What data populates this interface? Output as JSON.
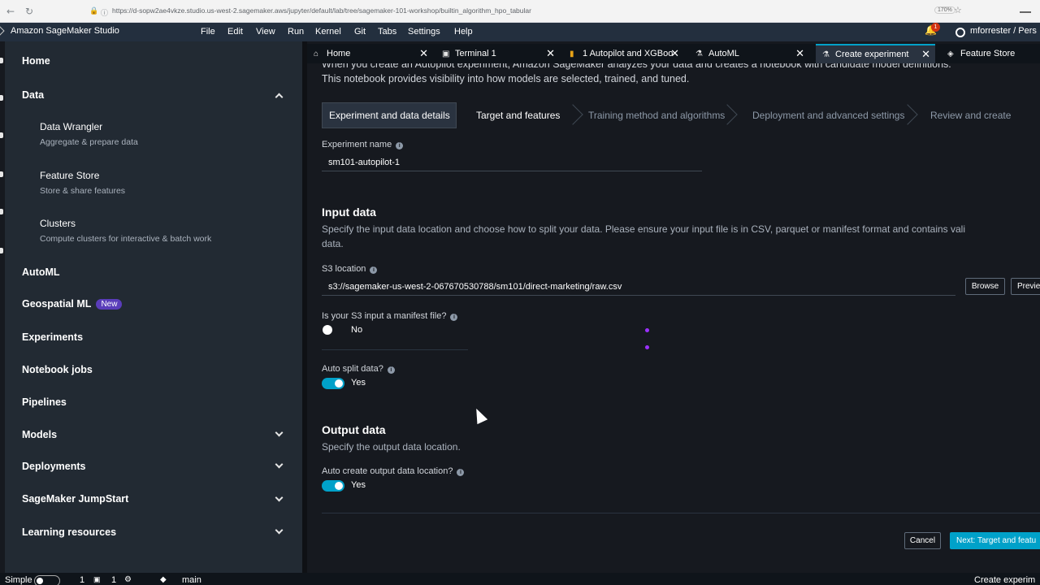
{
  "browser": {
    "url": "https://d-sopw2ae4vkze.studio.us-west-2.sagemaker.aws/jupyter/default/lab/tree/sagemaker-101-workshop/builtin_algorithm_hpo_tabular",
    "zoom": "170%"
  },
  "app": {
    "title": "Amazon SageMaker Studio",
    "menu": [
      "File",
      "Edit",
      "View",
      "Run",
      "Kernel",
      "Git",
      "Tabs",
      "Settings",
      "Help"
    ],
    "notification_count": "1",
    "user": "mforrester / Pers"
  },
  "sidebar": {
    "home": "Home",
    "data": {
      "label": "Data",
      "items": [
        {
          "title": "Data Wrangler",
          "desc": "Aggregate & prepare data"
        },
        {
          "title": "Feature Store",
          "desc": "Store & share features"
        },
        {
          "title": "Clusters",
          "desc": "Compute clusters for interactive & batch work"
        }
      ]
    },
    "automl": "AutoML",
    "geospatial": "Geospatial ML",
    "new_badge": "New",
    "experiments": "Experiments",
    "notebook_jobs": "Notebook jobs",
    "pipelines": "Pipelines",
    "models": "Models",
    "deployments": "Deployments",
    "jumpstart": "SageMaker JumpStart",
    "learning": "Learning resources"
  },
  "tabs": [
    {
      "label": "Home",
      "icon": "home-icon"
    },
    {
      "label": "Terminal 1",
      "icon": "terminal-icon"
    },
    {
      "label": "1 Autopilot and XGBoo",
      "icon": "notebook-icon"
    },
    {
      "label": "AutoML",
      "icon": "flask-icon"
    },
    {
      "label": "Create experiment",
      "icon": "flask-icon"
    },
    {
      "label": "Feature Store",
      "icon": "feature-store-icon"
    }
  ],
  "page": {
    "intro_line1": "When you create an Autopilot experiment, Amazon SageMaker analyzes your data and creates a notebook with candidate model definitions.",
    "intro_line2": "This notebook provides visibility into how models are selected, trained, and tuned.",
    "steps": [
      {
        "label": "Experiment and data details",
        "state": "active"
      },
      {
        "label": "Target and features",
        "state": "enabled"
      },
      {
        "label": "Training method and algorithms",
        "state": "disabled"
      },
      {
        "label": "Deployment and advanced settings",
        "state": "disabled"
      },
      {
        "label": "Review and create",
        "state": "disabled"
      }
    ],
    "experiment_name_label": "Experiment name",
    "experiment_name_value": "sm101-autopilot-1",
    "input_title": "Input data",
    "input_desc_line1": "Specify the input data location and choose how to split your data. Please ensure your input file is in CSV, parquet or manifest format and contains vali",
    "input_desc_line2": "data.",
    "s3_label": "S3 location",
    "s3_value": "s3://sagemaker-us-west-2-067670530788/sm101/direct-marketing/raw.csv",
    "browse": "Browse",
    "preview": "Previe",
    "manifest_label": "Is your S3 input a manifest file?",
    "manifest_value": "No",
    "auto_split_label": "Auto split data?",
    "auto_split_value": "Yes",
    "output_title": "Output data",
    "output_desc": "Specify the output data location.",
    "auto_output_label": "Auto create output data location?",
    "auto_output_value": "Yes",
    "cancel": "Cancel",
    "next": "Next: Target and featu"
  },
  "status": {
    "mode": "Simple",
    "count1": "1",
    "count2": "1",
    "branch": "main",
    "right": "Create experim"
  },
  "colors": {
    "accent": "#00a1c9",
    "header": "#232f3e",
    "sidebar": "#222a33"
  }
}
